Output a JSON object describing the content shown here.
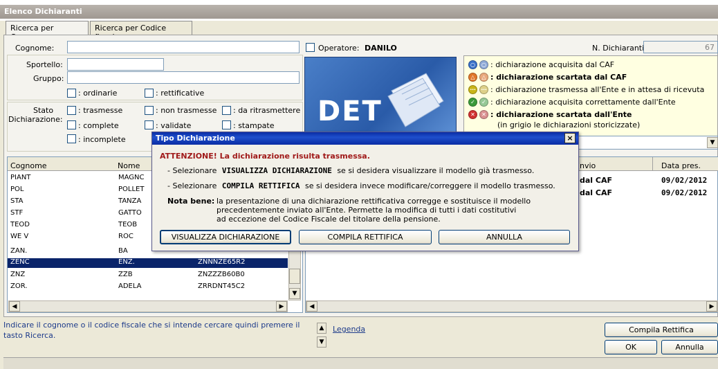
{
  "window": {
    "title": "Elenco Dichiaranti"
  },
  "tabs": [
    {
      "label": "Ricerca per Cognome"
    },
    {
      "label": "Ricerca per Codice fiscale"
    }
  ],
  "search": {
    "cognome_label": "Cognome:",
    "cognome_value": "",
    "operatore_label": "Operatore:",
    "operatore_value": "DANILO",
    "n_dichiaranti_label": "N. Dichiaranti:",
    "n_dichiaranti_value": "67",
    "sportello_label": "Sportello:",
    "gruppo_label": "Gruppo:",
    "ordinarie_label": ": ordinarie",
    "rettificative_label": ": rettificative",
    "stato_label_1": "Stato",
    "stato_label_2": "Dichiarazione:",
    "trasmesse_label": ": trasmesse",
    "non_trasmesse_label": ": non trasmesse",
    "da_ritrasmettere_label": ": da ritrasmettere",
    "complete_label": ": complete",
    "validate_label": ": validate",
    "stampate_label": ": stampate",
    "incomplete_label": ": incomplete"
  },
  "banner": {
    "text": "DET"
  },
  "legend_items": [
    {
      "symbol": "○",
      "color": "#3a70c8",
      "text": ": dichiarazione acquisita dal CAF",
      "bold": false
    },
    {
      "symbol": "△",
      "color": "#e0762a",
      "text": ": dichiarazione scartata dal CAF",
      "bold": true
    },
    {
      "symbol": "⋯",
      "color": "#c8b418",
      "text": ": dichiarazione trasmessa all'Ente e in attesa di ricevuta",
      "bold": false
    },
    {
      "symbol": "✓",
      "color": "#3a9a3a",
      "text": ": dichiarazione acquisita correttamente dall'Ente",
      "bold": false
    },
    {
      "symbol": "✕",
      "color": "#d03030",
      "text": ": dichiarazione scartata dall'Ente",
      "bold": true
    }
  ],
  "legend_note": "(in grigio le dichiarazioni storicizzate)",
  "left_table": {
    "headers": [
      "Cognome",
      "Nome"
    ],
    "rows": [
      {
        "cognome": "PIANT",
        "nome": "MAGNC",
        "cf": ""
      },
      {
        "cognome": "POL",
        "nome": "POLLET",
        "cf": ""
      },
      {
        "cognome": "STA",
        "nome": "TANZA",
        "cf": ""
      },
      {
        "cognome": "STF",
        "nome": "GATTO",
        "cf": ""
      },
      {
        "cognome": "TEOD",
        "nome": "TEOB",
        "cf": ""
      },
      {
        "cognome": "WE V",
        "nome": "ROC",
        "cf": ""
      },
      {
        "cognome": "ZAN.",
        "nome": "BA",
        "cf": ""
      },
      {
        "cognome": "ZENC",
        "nome": "ENZ.",
        "cf": "ZNNNZE65R2"
      },
      {
        "cognome": "ZNZ",
        "nome": "ZZB",
        "cf": "ZNZZZB60B0"
      },
      {
        "cognome": "ZOR.",
        "nome": "ADELA",
        "cf": "ZRRDNT45C2"
      }
    ]
  },
  "right_table": {
    "headers": [
      "nvio",
      "Data pres."
    ],
    "rows": [
      {
        "invio": "dal CAF",
        "data": "09/02/2012"
      },
      {
        "invio": "dal CAF",
        "data": "09/02/2012"
      }
    ]
  },
  "status": {
    "hint": "Indicare il cognome o il codice fiscale che si intende cercare quindi premere il tasto Ricerca.",
    "legenda_link": "Legenda"
  },
  "buttons": {
    "compila_rettifica": "Compila Rettifica",
    "ok": "OK",
    "annulla": "Annulla"
  },
  "dialog": {
    "title": "Tipo Dichiarazione",
    "close": "×",
    "attention": "ATTENZIONE! La dichiarazione risulta trasmessa.",
    "line1_pre": "- Selezionare",
    "line1_bold": "VISUALIZZA DICHIARAZIONE",
    "line1_post": "se si desidera visualizzare il modello già trasmesso.",
    "line2_pre": "- Selezionare",
    "line2_bold": "COMPILA RETTIFICA",
    "line2_post": "se si desidera invece modificare/correggere il modello trasmesso.",
    "nota_label": "Nota bene:",
    "nota_line1": "la presentazione di una dichiarazione rettificativa corregge e sostituisce il modello",
    "nota_line2": "precedentemente inviato all'Ente. Permette la modifica di tutti i dati costitutivi",
    "nota_line3": "ad eccezione del Codice Fiscale del titolare della pensione.",
    "btn_visualizza": "VISUALIZZA DICHIARAZIONE",
    "btn_compila": "COMPILA RETTIFICA",
    "btn_annulla": "ANNULLA"
  }
}
